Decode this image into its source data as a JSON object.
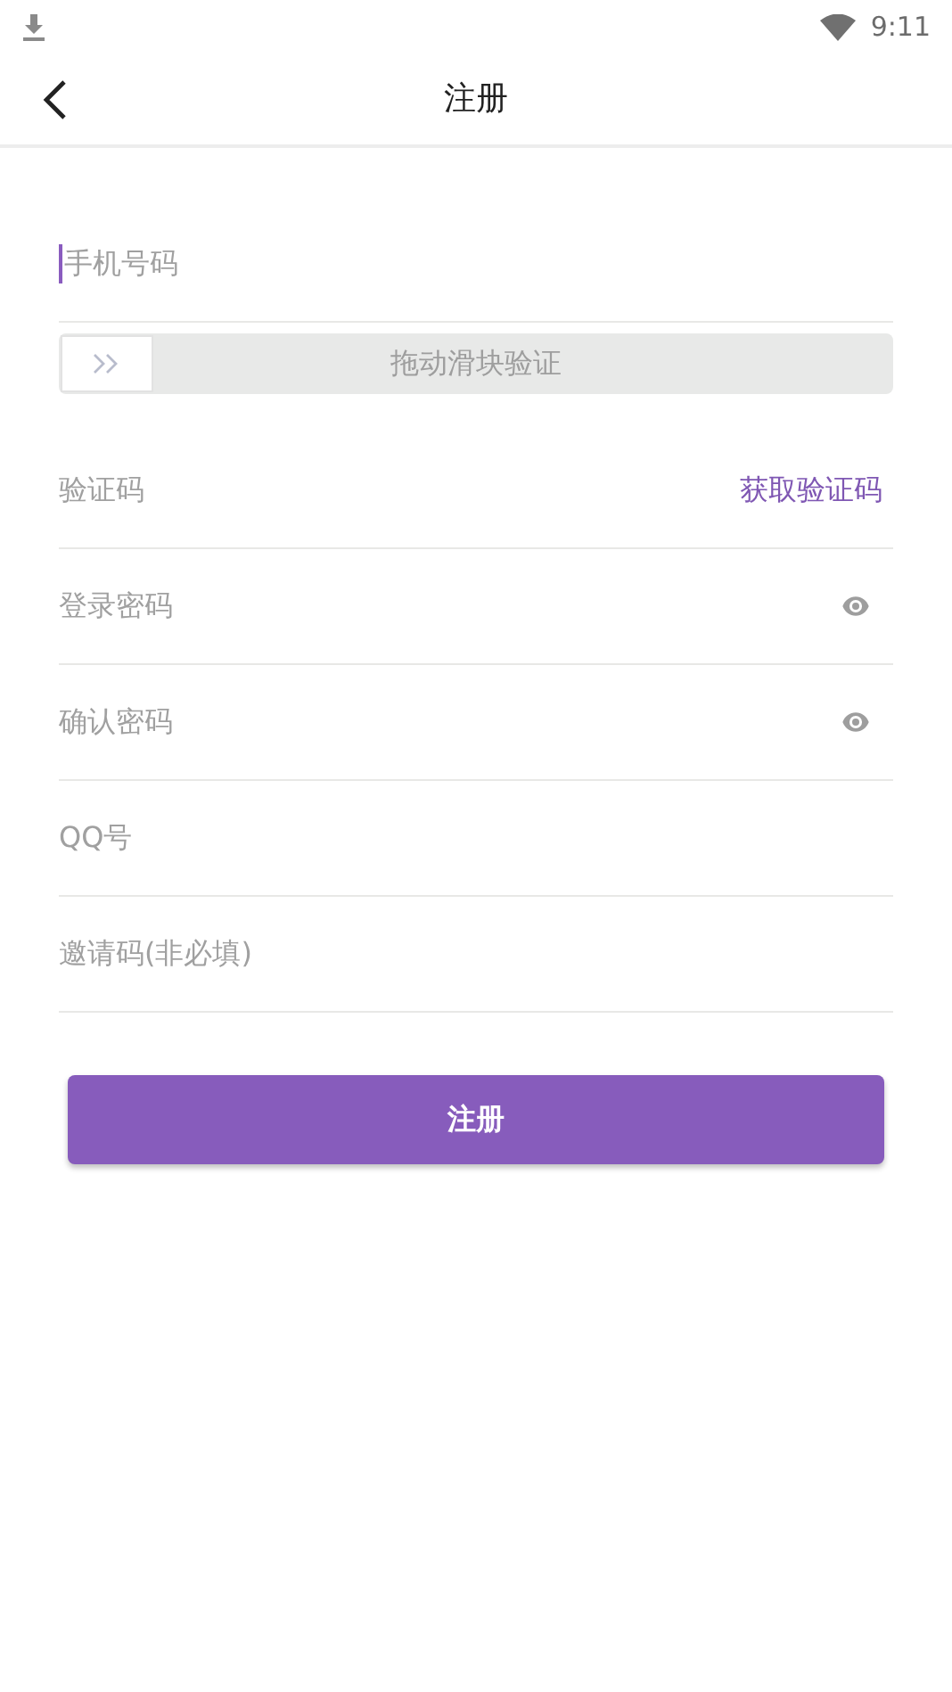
{
  "status_bar": {
    "time": "9:11"
  },
  "header": {
    "title": "注册"
  },
  "fields": [
    {
      "kind": "input",
      "placeholder": "手机号码",
      "focused": true
    },
    {
      "kind": "slider",
      "label": "拖动滑块验证",
      "level": 0
    },
    {
      "kind": "code",
      "placeholder": "验证码",
      "action": "获取验证码",
      "focused": false
    },
    {
      "kind": "password",
      "placeholder": "登录密码",
      "focused": false
    },
    {
      "kind": "password",
      "placeholder": "确认密码",
      "focused": false
    },
    {
      "kind": "input",
      "placeholder": "QQ号",
      "focused": false
    },
    {
      "kind": "input",
      "placeholder": "邀请码(非必填)",
      "focused": false
    }
  ],
  "submit": {
    "label": "注册"
  }
}
